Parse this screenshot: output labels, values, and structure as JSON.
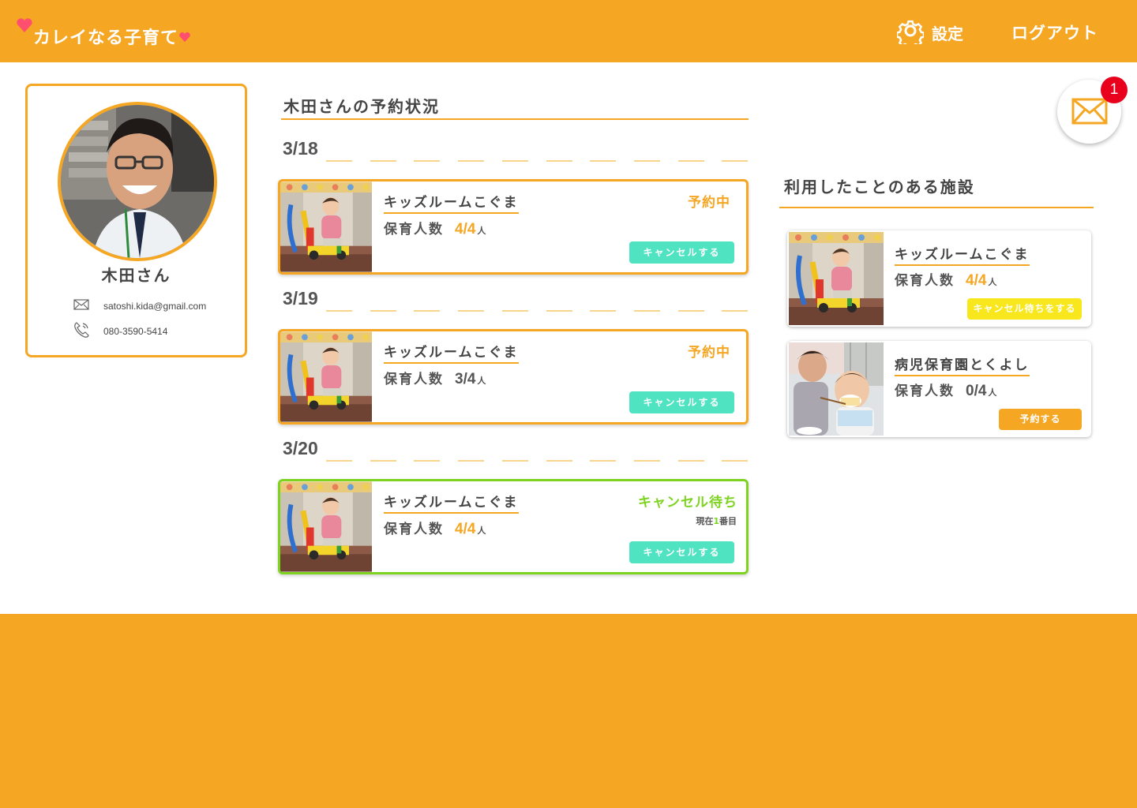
{
  "app": {
    "logo_text": "カレイなる子育て"
  },
  "nav": {
    "settings_label": "設定",
    "logout_label": "ログアウト"
  },
  "profile": {
    "name": "木田さん",
    "email": "satoshi.kida@gmail.com",
    "phone": "080-3590-5414"
  },
  "reservations": {
    "title": "木田さんの予約状況",
    "days": [
      {
        "date": "3/18",
        "facility": "キッズルームこぐま",
        "capacity_label": "保育人数",
        "capacity": "4/4",
        "unit": "人",
        "status": "予約中",
        "button": "キャンセルする"
      },
      {
        "date": "3/19",
        "facility": "キッズルームこぐま",
        "capacity_label": "保育人数",
        "capacity": "3/4",
        "unit": "人",
        "status": "予約中",
        "button": "キャンセルする"
      },
      {
        "date": "3/20",
        "facility": "キッズルームこぐま",
        "capacity_label": "保育人数",
        "capacity": "4/4",
        "unit": "人",
        "status": "キャンセル待ち",
        "queue_prefix": "現在",
        "queue_number": "1",
        "queue_suffix": "番目",
        "button": "キャンセルする"
      }
    ]
  },
  "mail": {
    "badge_count": "1"
  },
  "facilities": {
    "title": "利用したことのある施設",
    "items": [
      {
        "name": "キッズルームこぐま",
        "capacity_label": "保育人数",
        "capacity": "4/4",
        "unit": "人",
        "button": "キャンセル待ちをする"
      },
      {
        "name": "病児保育園とくよし",
        "capacity_label": "保育人数",
        "capacity": "0/4",
        "unit": "人",
        "button": "予約する"
      }
    ]
  },
  "colors": {
    "brand_orange": "#f5a623",
    "cancel_teal": "#50e3c2",
    "waitlist_green": "#7ed321",
    "wait_button_yellow": "#f8e71c",
    "badge_red": "#e8001c"
  }
}
